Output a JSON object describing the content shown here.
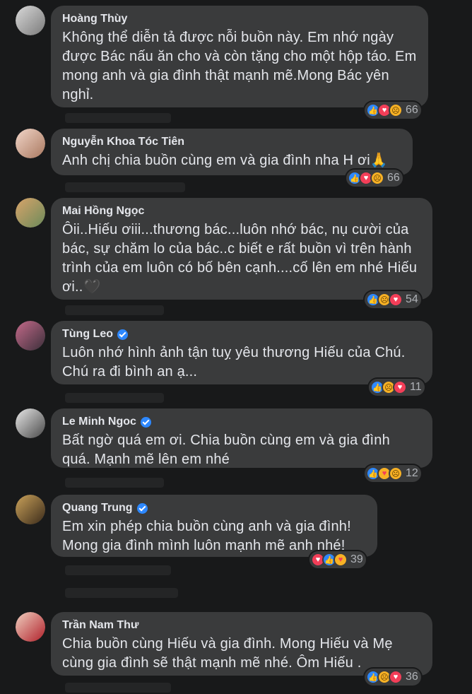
{
  "comments": [
    {
      "name": "Hoàng Thùy",
      "verified": false,
      "text": "Không thể diễn tả được nỗi buồn này. Em nhớ ngày được Bác nấu ăn cho và còn tặng cho một hộp táo. Em mong anh và gia đình thật mạnh mẽ.Mong Bác yên nghỉ.",
      "reactions": [
        "like",
        "love",
        "sad"
      ],
      "count": "66"
    },
    {
      "name": "Nguyễn Khoa Tóc Tiên",
      "verified": false,
      "text": "Anh chị chia buồn cùng em và gia đình nha H ơi🙏",
      "reactions": [
        "like",
        "love",
        "sad"
      ],
      "count": "66"
    },
    {
      "name": "Mai Hồng Ngọc",
      "verified": false,
      "text": "Ôii..Hiếu ơiii...thương bác...luôn nhớ bác, nụ cười của bác, sự chăm lo của bác..c biết e rất buồn vì trên hành trình của em luôn có bố bên cạnh....cố lên em nhé Hiếu ơi..🖤",
      "reactions": [
        "like",
        "sad",
        "love"
      ],
      "count": "54"
    },
    {
      "name": "Tùng Leo",
      "verified": true,
      "text": "Luôn nhớ hình ảnh tận tuỵ yêu thương Hiếu của Chú. Chú ra đi bình an ạ...",
      "reactions": [
        "like",
        "sad",
        "love"
      ],
      "count": "11"
    },
    {
      "name": "Le Minh Ngoc",
      "verified": true,
      "text": "Bất ngờ quá em ơi. Chia buồn cùng em và gia đình quá. Mạnh mẽ lên em nhé",
      "reactions": [
        "like",
        "care",
        "sad"
      ],
      "count": "12"
    },
    {
      "name": "Quang Trung",
      "verified": true,
      "text": "Em xin phép chia buồn cùng anh và gia đình! Mong gia đình mình luôn mạnh mẽ anh nhé!",
      "reactions": [
        "love",
        "like",
        "care"
      ],
      "count": "39"
    },
    {
      "name": "Trần Nam Thư",
      "verified": false,
      "text": "Chia buồn cùng Hiếu và gia đình. Mong Hiếu và Mẹ cùng gia đình sẽ thật mạnh mẽ nhé. Ôm Hiếu .",
      "reactions": [
        "like",
        "sad",
        "love"
      ],
      "count": "36"
    }
  ],
  "icons": {
    "like": "like-icon",
    "love": "love-icon",
    "sad": "sad-icon",
    "care": "care-icon"
  },
  "colors": {
    "background": "#18191a",
    "bubble": "#3a3b3c",
    "text": "#e4e6eb",
    "muted": "#b0b3b8",
    "verified": "#2d88ff"
  }
}
